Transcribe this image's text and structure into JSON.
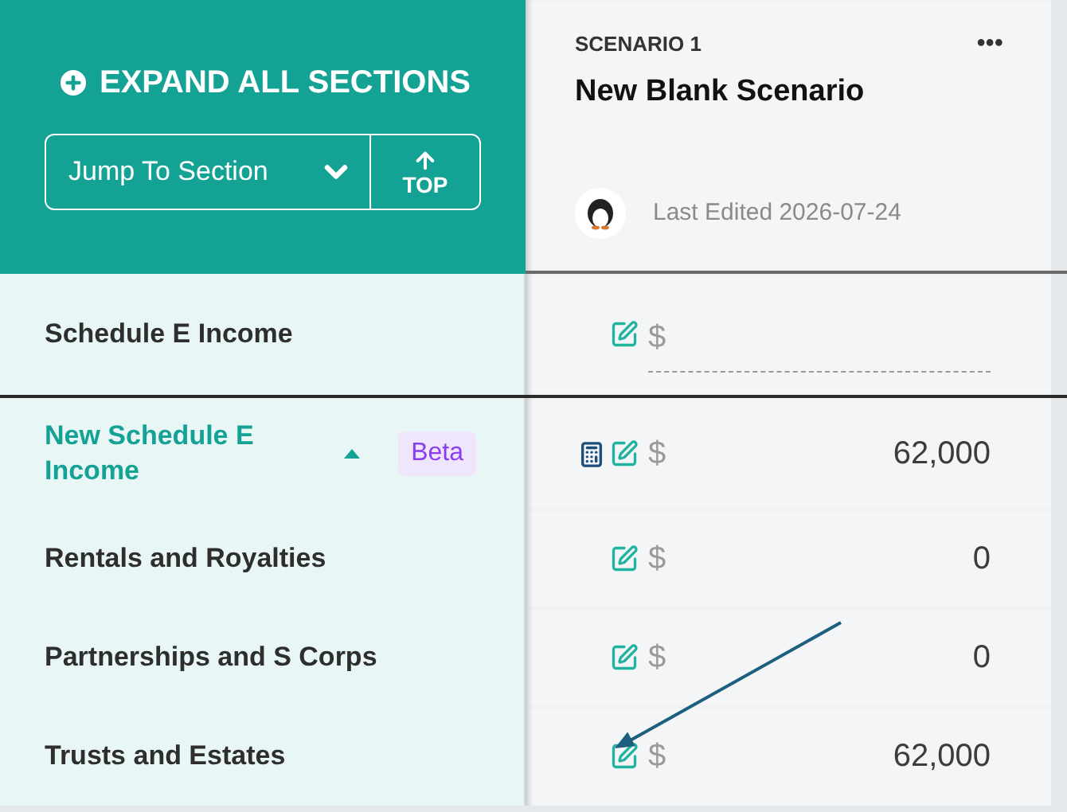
{
  "header": {
    "expand_all": "EXPAND ALL SECTIONS",
    "jump_to": "Jump To Section",
    "top_button": "TOP"
  },
  "scenario": {
    "label": "SCENARIO 1",
    "title": "New Blank Scenario",
    "more": "•••",
    "last_edited": "Last Edited 2026-07-24"
  },
  "rows": [
    {
      "kind": "section",
      "label": "Schedule E Income",
      "currency": "$",
      "value": null
    },
    {
      "kind": "parent",
      "label": "New Schedule E Income",
      "expanded": true,
      "badge": "Beta",
      "currency": "$",
      "value": "62,000",
      "calculator": true
    },
    {
      "kind": "item",
      "label": "Rentals and Royalties",
      "currency": "$",
      "value": "0"
    },
    {
      "kind": "item",
      "label": "Partnerships and S Corps",
      "currency": "$",
      "value": "0"
    },
    {
      "kind": "item",
      "label": "Trusts and Estates",
      "currency": "$",
      "value": "62,000"
    }
  ]
}
